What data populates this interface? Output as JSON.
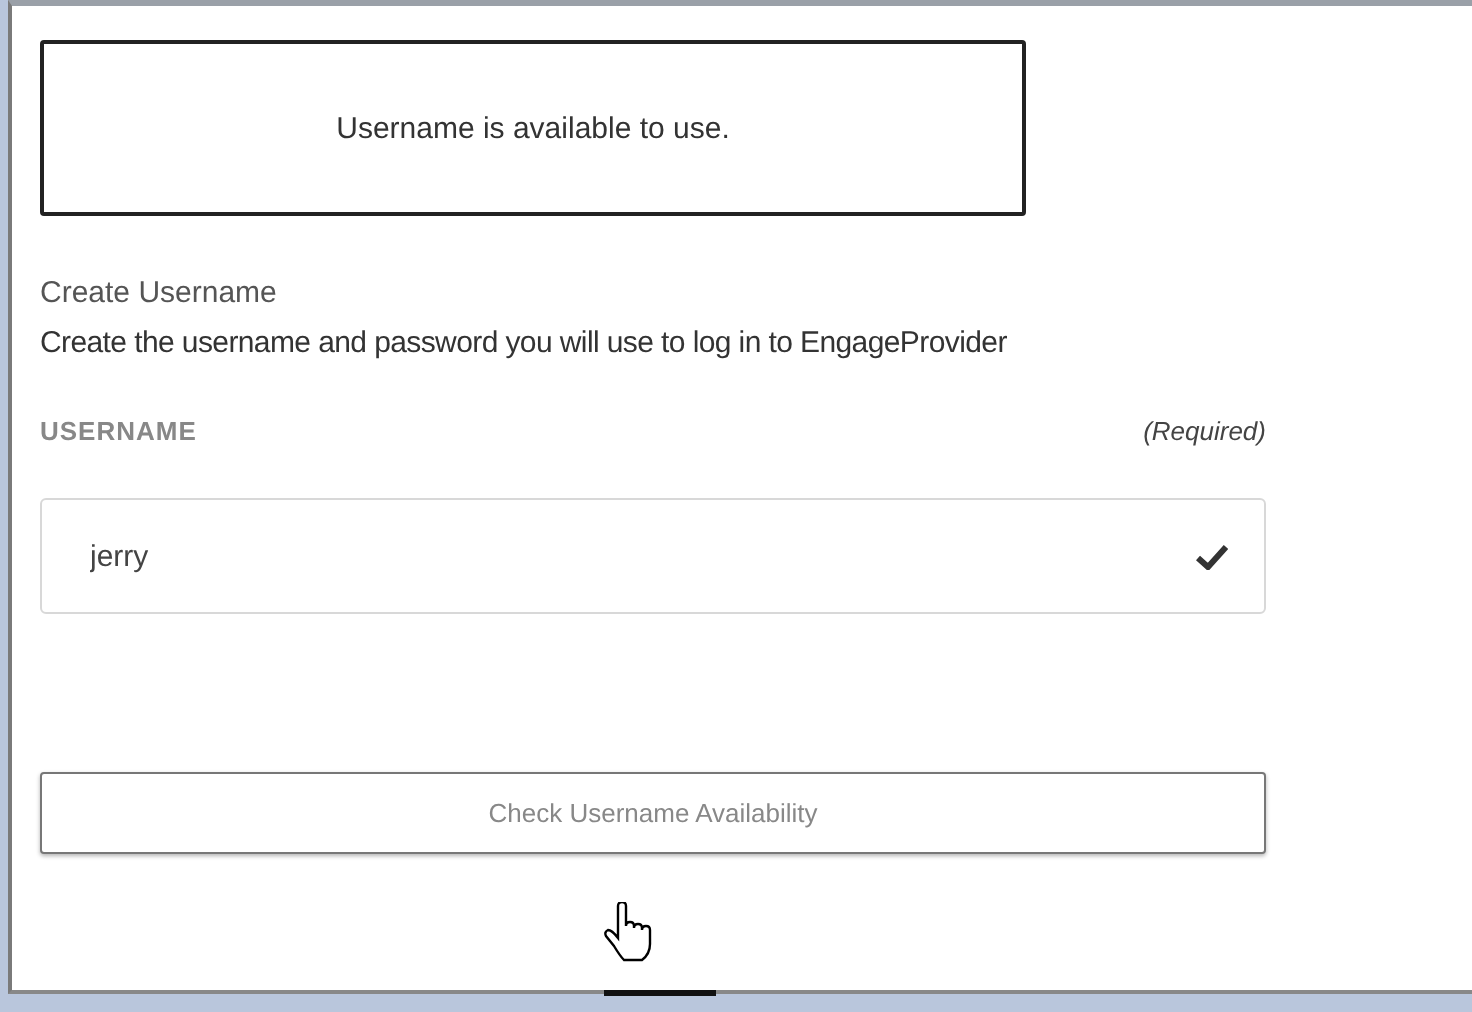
{
  "alert": {
    "message": "Username is available to use."
  },
  "section": {
    "title": "Create Username",
    "description": "Create the username and password you will use to log in to EngageProvider"
  },
  "username_field": {
    "label": "USERNAME",
    "required_note": "(Required)",
    "value": "jerry",
    "valid": true
  },
  "check_button": {
    "label": "Check Username Availability"
  }
}
